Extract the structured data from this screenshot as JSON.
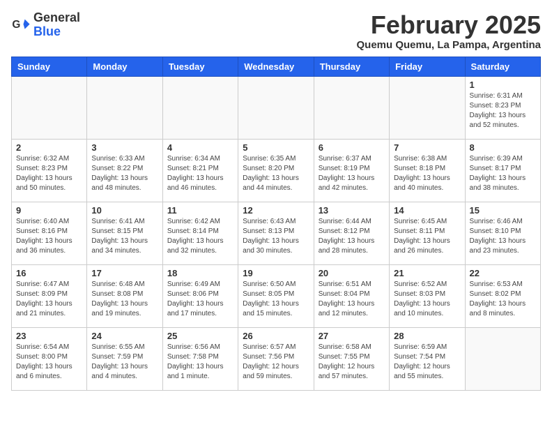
{
  "logo": {
    "general": "General",
    "blue": "Blue"
  },
  "title": "February 2025",
  "subtitle": "Quemu Quemu, La Pampa, Argentina",
  "days": [
    "Sunday",
    "Monday",
    "Tuesday",
    "Wednesday",
    "Thursday",
    "Friday",
    "Saturday"
  ],
  "weeks": [
    [
      {
        "day": "",
        "info": ""
      },
      {
        "day": "",
        "info": ""
      },
      {
        "day": "",
        "info": ""
      },
      {
        "day": "",
        "info": ""
      },
      {
        "day": "",
        "info": ""
      },
      {
        "day": "",
        "info": ""
      },
      {
        "day": "1",
        "info": "Sunrise: 6:31 AM\nSunset: 8:23 PM\nDaylight: 13 hours\nand 52 minutes."
      }
    ],
    [
      {
        "day": "2",
        "info": "Sunrise: 6:32 AM\nSunset: 8:23 PM\nDaylight: 13 hours\nand 50 minutes."
      },
      {
        "day": "3",
        "info": "Sunrise: 6:33 AM\nSunset: 8:22 PM\nDaylight: 13 hours\nand 48 minutes."
      },
      {
        "day": "4",
        "info": "Sunrise: 6:34 AM\nSunset: 8:21 PM\nDaylight: 13 hours\nand 46 minutes."
      },
      {
        "day": "5",
        "info": "Sunrise: 6:35 AM\nSunset: 8:20 PM\nDaylight: 13 hours\nand 44 minutes."
      },
      {
        "day": "6",
        "info": "Sunrise: 6:37 AM\nSunset: 8:19 PM\nDaylight: 13 hours\nand 42 minutes."
      },
      {
        "day": "7",
        "info": "Sunrise: 6:38 AM\nSunset: 8:18 PM\nDaylight: 13 hours\nand 40 minutes."
      },
      {
        "day": "8",
        "info": "Sunrise: 6:39 AM\nSunset: 8:17 PM\nDaylight: 13 hours\nand 38 minutes."
      }
    ],
    [
      {
        "day": "9",
        "info": "Sunrise: 6:40 AM\nSunset: 8:16 PM\nDaylight: 13 hours\nand 36 minutes."
      },
      {
        "day": "10",
        "info": "Sunrise: 6:41 AM\nSunset: 8:15 PM\nDaylight: 13 hours\nand 34 minutes."
      },
      {
        "day": "11",
        "info": "Sunrise: 6:42 AM\nSunset: 8:14 PM\nDaylight: 13 hours\nand 32 minutes."
      },
      {
        "day": "12",
        "info": "Sunrise: 6:43 AM\nSunset: 8:13 PM\nDaylight: 13 hours\nand 30 minutes."
      },
      {
        "day": "13",
        "info": "Sunrise: 6:44 AM\nSunset: 8:12 PM\nDaylight: 13 hours\nand 28 minutes."
      },
      {
        "day": "14",
        "info": "Sunrise: 6:45 AM\nSunset: 8:11 PM\nDaylight: 13 hours\nand 26 minutes."
      },
      {
        "day": "15",
        "info": "Sunrise: 6:46 AM\nSunset: 8:10 PM\nDaylight: 13 hours\nand 23 minutes."
      }
    ],
    [
      {
        "day": "16",
        "info": "Sunrise: 6:47 AM\nSunset: 8:09 PM\nDaylight: 13 hours\nand 21 minutes."
      },
      {
        "day": "17",
        "info": "Sunrise: 6:48 AM\nSunset: 8:08 PM\nDaylight: 13 hours\nand 19 minutes."
      },
      {
        "day": "18",
        "info": "Sunrise: 6:49 AM\nSunset: 8:06 PM\nDaylight: 13 hours\nand 17 minutes."
      },
      {
        "day": "19",
        "info": "Sunrise: 6:50 AM\nSunset: 8:05 PM\nDaylight: 13 hours\nand 15 minutes."
      },
      {
        "day": "20",
        "info": "Sunrise: 6:51 AM\nSunset: 8:04 PM\nDaylight: 13 hours\nand 12 minutes."
      },
      {
        "day": "21",
        "info": "Sunrise: 6:52 AM\nSunset: 8:03 PM\nDaylight: 13 hours\nand 10 minutes."
      },
      {
        "day": "22",
        "info": "Sunrise: 6:53 AM\nSunset: 8:02 PM\nDaylight: 13 hours\nand 8 minutes."
      }
    ],
    [
      {
        "day": "23",
        "info": "Sunrise: 6:54 AM\nSunset: 8:00 PM\nDaylight: 13 hours\nand 6 minutes."
      },
      {
        "day": "24",
        "info": "Sunrise: 6:55 AM\nSunset: 7:59 PM\nDaylight: 13 hours\nand 4 minutes."
      },
      {
        "day": "25",
        "info": "Sunrise: 6:56 AM\nSunset: 7:58 PM\nDaylight: 13 hours\nand 1 minute."
      },
      {
        "day": "26",
        "info": "Sunrise: 6:57 AM\nSunset: 7:56 PM\nDaylight: 12 hours\nand 59 minutes."
      },
      {
        "day": "27",
        "info": "Sunrise: 6:58 AM\nSunset: 7:55 PM\nDaylight: 12 hours\nand 57 minutes."
      },
      {
        "day": "28",
        "info": "Sunrise: 6:59 AM\nSunset: 7:54 PM\nDaylight: 12 hours\nand 55 minutes."
      },
      {
        "day": "",
        "info": ""
      }
    ]
  ]
}
